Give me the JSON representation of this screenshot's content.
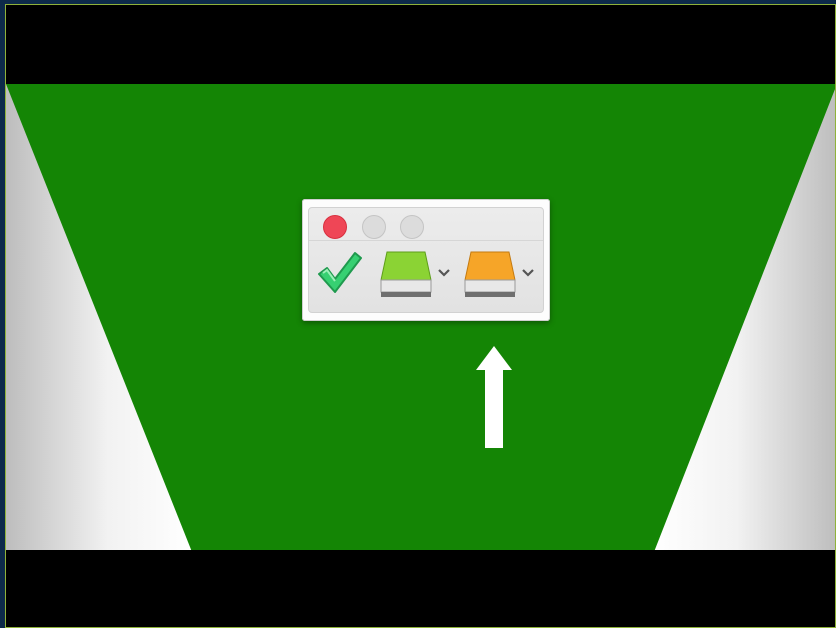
{
  "colors": {
    "green_screen": "#148505",
    "gray_side": "#d6d6d6",
    "close_red": "#ef4656",
    "disk_green": "#8bd334",
    "disk_orange": "#f6a528",
    "check_green": "#37d072",
    "arrow_white": "#ffffff"
  },
  "mini_window": {
    "traffic_lights": [
      "close-button",
      "minimize-button",
      "zoom-button"
    ],
    "toolbar_icons": [
      "checkmark-icon",
      "green-disk-icon",
      "orange-disk-icon"
    ],
    "menu_icons": [
      "chevron-down-icon",
      "chevron-down-icon"
    ]
  },
  "pointer": {
    "icon": "up-arrow-icon"
  }
}
